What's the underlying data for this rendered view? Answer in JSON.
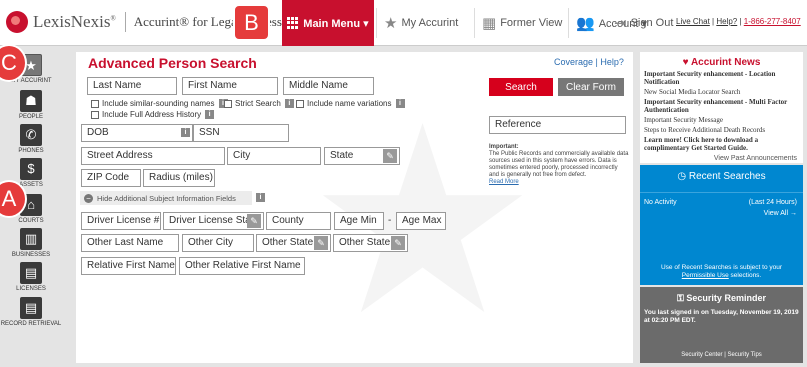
{
  "header": {
    "brand": "LexisNexis",
    "brand_mark": "®",
    "product": "Accurint® for Legal Professionals",
    "nav": {
      "main_menu": "Main Menu ▾",
      "my_accurint": "My Accurint",
      "former_view": "Former View",
      "account": "Account ▾",
      "sign_out": "Sign Out"
    },
    "util": {
      "live_chat": "Live Chat",
      "help": "Help?",
      "phone": "1-866-277-8407"
    }
  },
  "callouts": {
    "a": "A",
    "b": "B",
    "c": "C"
  },
  "sidebar": {
    "items": [
      {
        "label": "MY ACCURINT",
        "icon": "star-icon"
      },
      {
        "label": "PEOPLE",
        "icon": "person-icon"
      },
      {
        "label": "PHONES",
        "icon": "phone-icon"
      },
      {
        "label": "ASSETS",
        "icon": "dollar-icon"
      },
      {
        "label": "COURTS",
        "icon": "courthouse-icon"
      },
      {
        "label": "BUSINESSES",
        "icon": "building-icon"
      },
      {
        "label": "LICENSES",
        "icon": "license-icon"
      },
      {
        "label": "RECORD RETRIEVAL",
        "icon": "record-icon"
      }
    ]
  },
  "search": {
    "title": "Advanced Person Search",
    "coverage": "Coverage",
    "help": "Help?",
    "fields": {
      "last_name": "Last Name",
      "first_name": "First Name",
      "middle_name": "Middle Name",
      "dob": "DOB",
      "ssn": "SSN",
      "street": "Street Address",
      "city": "City",
      "state": "State",
      "zip": "ZIP Code",
      "radius": "Radius (miles)",
      "dl_number": "Driver License #",
      "dl_state": "Driver License State",
      "county": "County",
      "age_min": "Age Min",
      "age_max": "Age Max",
      "age_dash": "-",
      "other_last": "Other Last Name",
      "other_city": "Other City",
      "other_state_1": "Other State",
      "other_state_2": "Other State",
      "relative_first": "Relative First Name",
      "other_relative_first": "Other Relative First Name"
    },
    "options": {
      "similar_names": "Include similar-sounding names",
      "strict": "Strict Search",
      "name_variations": "Include name variations",
      "full_address": "Include Full Address History"
    },
    "toggle_label": "Hide Additional Subject Information Fields",
    "search_button": "Search",
    "clear_button": "Clear Form",
    "reference": "Reference",
    "important_title": "Important:",
    "important_text": "The Public Records and commercially available data sources used in this system have errors. Data is sometimes entered poorly, processed incorrectly and is generally not free from defect.",
    "read_more": "Read More"
  },
  "news": {
    "title": "Accurint News",
    "items": [
      {
        "text": "Important Security enhancement - Location Notification",
        "bold": true
      },
      {
        "text": "New Social Media Locator Search",
        "bold": false
      },
      {
        "text": "Important Security enhancement - Multi Factor Authentication",
        "bold": true
      },
      {
        "text": "Important Security Message",
        "bold": false
      },
      {
        "text": "Steps to Receive Additional Death Records",
        "bold": false
      },
      {
        "text": "Learn more! Click here to download a complimentary Get Started Guide.",
        "bold": true
      }
    ],
    "view_past": "View Past Announcements"
  },
  "recent": {
    "title": "Recent Searches",
    "no_activity": "No Activity",
    "period": "(Last 24 Hours)",
    "view_all": "View All →",
    "note_prefix": "Use of Recent Searches is subject to your",
    "note_link": "Permissible Use",
    "note_suffix": "selections."
  },
  "security": {
    "title": "Security Reminder",
    "text": "You last signed in on Tuesday, November 19, 2019 at 02:20 PM EDT.",
    "links": "Security Center | Security Tips"
  },
  "colors": {
    "brand_red": "#c8102e",
    "recent_blue": "#0087d0",
    "security_gray": "#6b6b6b"
  }
}
